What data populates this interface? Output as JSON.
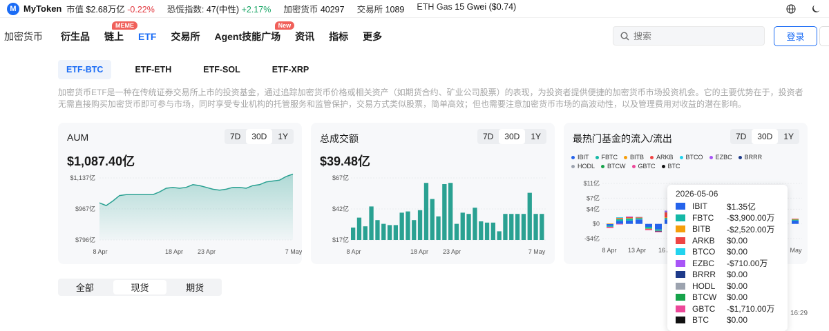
{
  "topbar": {
    "logo": "MyToken",
    "stats": [
      {
        "label": "市值",
        "value": "$2.68万亿",
        "change": "-0.22%",
        "dir": "neg"
      },
      {
        "label": "恐慌指数:",
        "value": "47(中性)",
        "change": "+2.17%",
        "dir": "pos"
      },
      {
        "label": "加密货币",
        "value": "40297",
        "change": "",
        "dir": ""
      },
      {
        "label": "交易所",
        "value": "1089",
        "change": "",
        "dir": ""
      },
      {
        "label": "ETH Gas",
        "value": "15 Gwei ($0.74)",
        "change": "",
        "dir": ""
      }
    ],
    "icons": [
      "globe-icon",
      "moon-icon"
    ]
  },
  "nav": {
    "items": [
      {
        "label": "加密货币",
        "badge": ""
      },
      {
        "label": "衍生品",
        "badge": ""
      },
      {
        "label": "链上",
        "badge": "MEME"
      },
      {
        "label": "ETF",
        "badge": ""
      },
      {
        "label": "交易所",
        "badge": ""
      },
      {
        "label": "Agent技能广场",
        "badge": "New"
      },
      {
        "label": "资讯",
        "badge": ""
      },
      {
        "label": "指标",
        "badge": ""
      },
      {
        "label": "更多",
        "badge": ""
      }
    ],
    "active": "ETF",
    "search_placeholder": "搜索",
    "login_label": "登录"
  },
  "etf_tabs": [
    "ETF-BTC",
    "ETF-ETH",
    "ETF-SOL",
    "ETF-XRP"
  ],
  "description": "加密货币ETF是一种在传统证券交易所上市的投资基金，通过追踪加密货币价格或相关资产（如期货合约、矿业公司股票）的表现，为投资者提供便捷的加密货币市场投资机会。它的主要优势在于，投资者无需直接购买加密货币即可参与市场，同时享受专业机构的托管服务和监管保护，交易方式类似股票，简单高效；但也需要注意加密货币市场的高波动性，以及管理费用对收益的潜在影响。",
  "periods": [
    "7D",
    "30D",
    "1Y"
  ],
  "active_period": "30D",
  "cards": {
    "aum": {
      "title": "AUM",
      "value": "$1,087.40亿"
    },
    "volume": {
      "title": "总成交额",
      "value": "$39.48亿"
    },
    "flows": {
      "title": "最热门基金的流入/流出"
    }
  },
  "chart_data": [
    {
      "type": "area",
      "title": "AUM",
      "ytick_labels": [
        "$1,137亿",
        "$967亿",
        "$796亿"
      ],
      "yticks": [
        1137,
        967,
        796
      ],
      "ylim": [
        796,
        1137
      ],
      "xtick_labels": [
        "8 Apr",
        "18 Apr",
        "23 Apr",
        "7 May"
      ],
      "color": "#2aa192",
      "values": [
        1000,
        985,
        1010,
        1040,
        1045,
        1045,
        1045,
        1045,
        1045,
        1060,
        1080,
        1085,
        1080,
        1085,
        1100,
        1095,
        1085,
        1075,
        1070,
        1075,
        1085,
        1085,
        1080,
        1095,
        1100,
        1115,
        1120,
        1125,
        1145,
        1158
      ]
    },
    {
      "type": "bar",
      "title": "总成交额",
      "ytick_labels": [
        "$67亿",
        "$42亿",
        "$17亿"
      ],
      "yticks": [
        67,
        42,
        17
      ],
      "ylim": [
        17,
        67
      ],
      "xtick_labels": [
        "8 Apr",
        "18 Apr",
        "23 Apr",
        "7 May"
      ],
      "color": "#2aa192",
      "values": [
        27,
        35,
        28,
        44,
        33,
        30,
        29,
        29,
        39,
        40,
        33,
        41,
        63,
        50,
        36,
        62,
        63,
        30,
        39,
        38,
        43,
        32,
        31,
        31,
        24,
        38,
        38,
        38,
        38,
        55,
        38,
        38
      ]
    },
    {
      "type": "bar",
      "title": "最热门基金的流入/流出",
      "stacked": true,
      "ytick_labels": [
        "$11亿",
        "$7亿",
        "$4亿",
        "$0",
        "-$4亿"
      ],
      "yticks": [
        11,
        7,
        4,
        0,
        -4
      ],
      "ylim": [
        -4,
        11
      ],
      "xtick_labels": [
        "8 Apr",
        "13 Apr",
        "16 A",
        "May"
      ],
      "series": [
        {
          "name": "IBIT",
          "color": "#2563eb",
          "values": [
            -0.5,
            0.8,
            0.9,
            1.2,
            -0.8,
            -1.5,
            1.2,
            0.9,
            -0.6,
            0.4,
            -0.3,
            0.9
          ]
        },
        {
          "name": "FBTC",
          "color": "#14b8a6",
          "values": [
            -0.3,
            0.5,
            0.6,
            0.4,
            -0.5,
            -0.4,
            0.4,
            0.3,
            -0.4,
            0.2,
            -0.1,
            0.3
          ]
        },
        {
          "name": "BITB",
          "color": "#f59e0b",
          "values": [
            0.1,
            0.2,
            0.1,
            0.1,
            -0.1,
            0,
            0.2,
            0.1,
            0,
            0.1,
            0,
            0.1
          ]
        },
        {
          "name": "ARKB",
          "color": "#ef4444",
          "values": [
            -0.1,
            0.2,
            0.3,
            0.1,
            -0.1,
            -0.1,
            1.4,
            0.8,
            -0.1,
            0.1,
            0,
            0.1
          ]
        },
        {
          "name": "BTCO",
          "color": "#22d3ee",
          "values": [
            0,
            0.1,
            0,
            0,
            0,
            0,
            0.1,
            0,
            0,
            0,
            0,
            0
          ]
        },
        {
          "name": "EZBC",
          "color": "#a855f7",
          "values": [
            0,
            0,
            0.1,
            0,
            0,
            0,
            0.3,
            0,
            0,
            0,
            0,
            0
          ]
        },
        {
          "name": "BRRR",
          "color": "#1e3a8a",
          "values": [
            0,
            0,
            0,
            0,
            0,
            -0.1,
            0,
            0,
            0,
            0,
            0,
            0
          ]
        },
        {
          "name": "HODL",
          "color": "#9ca3af",
          "values": [
            0,
            0,
            0,
            0.1,
            0,
            0,
            0,
            0,
            0,
            0,
            0,
            0
          ]
        },
        {
          "name": "BTCW",
          "color": "#16a34a",
          "values": [
            0,
            0,
            0,
            0,
            0,
            0,
            0,
            0,
            0,
            0,
            0,
            0
          ]
        },
        {
          "name": "GBTC",
          "color": "#ec4899",
          "values": [
            -0.2,
            -0.1,
            0,
            0,
            -0.2,
            -0.1,
            0,
            0,
            -0.1,
            0,
            0,
            0
          ]
        },
        {
          "name": "BTC",
          "color": "#111111",
          "values": [
            0,
            0,
            0,
            0,
            0,
            0,
            0,
            0,
            0,
            0,
            0,
            0
          ]
        }
      ]
    }
  ],
  "tooltip": {
    "date": "2026-05-06",
    "rows": [
      {
        "name": "IBIT",
        "value": "$1.35亿",
        "color": "#2563eb"
      },
      {
        "name": "FBTC",
        "value": "-$3,900.00万",
        "color": "#14b8a6"
      },
      {
        "name": "BITB",
        "value": "-$2,520.00万",
        "color": "#f59e0b"
      },
      {
        "name": "ARKB",
        "value": "$0.00",
        "color": "#ef4444"
      },
      {
        "name": "BTCO",
        "value": "$0.00",
        "color": "#22d3ee"
      },
      {
        "name": "EZBC",
        "value": "-$710.00万",
        "color": "#a855f7"
      },
      {
        "name": "BRRR",
        "value": "$0.00",
        "color": "#1e3a8a"
      },
      {
        "name": "HODL",
        "value": "$0.00",
        "color": "#9ca3af"
      },
      {
        "name": "BTCW",
        "value": "$0.00",
        "color": "#16a34a"
      },
      {
        "name": "GBTC",
        "value": "-$1,710.00万",
        "color": "#ec4899"
      },
      {
        "name": "BTC",
        "value": "$0.00",
        "color": "#111111"
      }
    ]
  },
  "update_time": "16:29",
  "market_tabs": [
    "全部",
    "现货",
    "期货"
  ],
  "active_market_tab": "现货"
}
